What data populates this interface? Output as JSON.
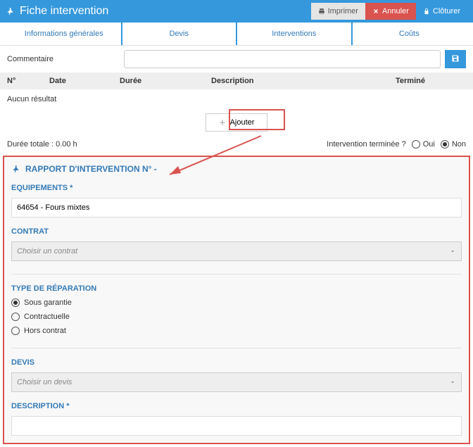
{
  "header": {
    "title": "Fiche intervention",
    "buttons": {
      "print": "Imprimer",
      "cancel": "Annuler",
      "close": "Clôturer"
    }
  },
  "tabs": {
    "info": "Informations générales",
    "devis": "Devis",
    "interventions": "Interventions",
    "costs": "Coûts"
  },
  "comment": {
    "label": "Commentaire",
    "value": ""
  },
  "table": {
    "headers": {
      "num": "N°",
      "date": "Date",
      "duration": "Durée",
      "description": "Description",
      "finished": "Terminé"
    },
    "empty_text": "Aucun résultat",
    "add_label": "Ajouter"
  },
  "duration_total": "Durée totale : 0.00 h",
  "finished_question": {
    "label": "Intervention terminée ?",
    "yes": "Oui",
    "no": "Non",
    "selected": "no"
  },
  "report": {
    "title": "RAPPORT D'INTERVENTION N°  -",
    "equipment_label": "EQUIPEMENTS *",
    "equipment_value": "64654 - Fours mixtes",
    "contract_label": "CONTRAT",
    "contract_placeholder": "Choisir un contrat",
    "repair_type_label": "TYPE DE RÉPARATION",
    "repair_options": {
      "warranty": "Sous garantie",
      "contractual": "Contractuelle",
      "out_of_contract": "Hors contrat"
    },
    "repair_selected": "warranty",
    "devis_label": "DEVIS",
    "devis_placeholder": "Choisir un devis",
    "description_label": "DESCRIPTION *",
    "description_value": ""
  }
}
